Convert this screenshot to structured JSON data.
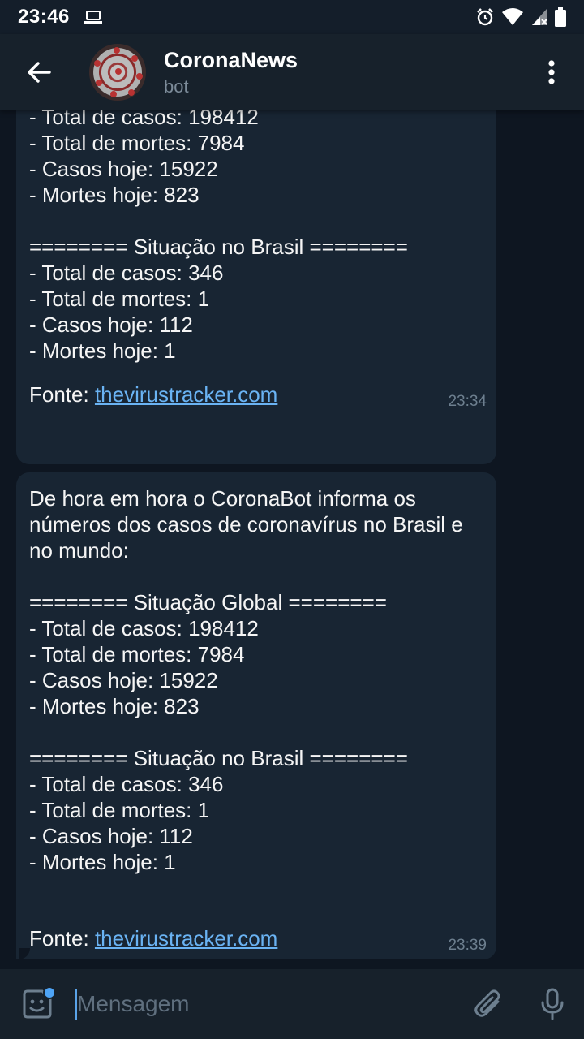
{
  "status_bar": {
    "time": "23:46",
    "icons": [
      "laptop-icon",
      "alarm-icon",
      "wifi-icon",
      "signal-icon",
      "battery-icon"
    ]
  },
  "header": {
    "title": "CoronaNews",
    "subtitle": "bot",
    "back_icon": "arrow-left-icon",
    "menu_icon": "more-vertical-icon"
  },
  "messages": [
    {
      "text": "- Total de casos: 198412\n- Total de mortes: 7984\n- Casos hoje: 15922\n- Mortes hoje: 823\n\n======== Situação no Brasil ========\n- Total de casos: 346\n- Total de mortes: 1\n- Casos hoje: 112\n- Mortes hoje: 1",
      "source_label": "Fonte: ",
      "source_link": "thevirustracker.com",
      "time": "23:34"
    },
    {
      "text": "De hora em hora o CoronaBot informa os\nnúmeros dos casos de coronavírus no Brasil e\nno mundo:\n\n======== Situação Global ========\n- Total de casos: 198412\n- Total de mortes: 7984\n- Casos hoje: 15922\n- Mortes hoje: 823\n\n======== Situação no Brasil ========\n- Total de casos: 346\n- Total de mortes: 1\n- Casos hoje: 112\n- Mortes hoje: 1",
      "source_label": "Fonte: ",
      "source_link": "thevirustracker.com",
      "time": "23:39"
    }
  ],
  "input": {
    "placeholder": "Mensagem"
  },
  "colors": {
    "background": "#0e1621",
    "header": "#17212b",
    "bubble": "#182533",
    "link": "#6ab3f3",
    "accent": "#4ea4f6"
  }
}
